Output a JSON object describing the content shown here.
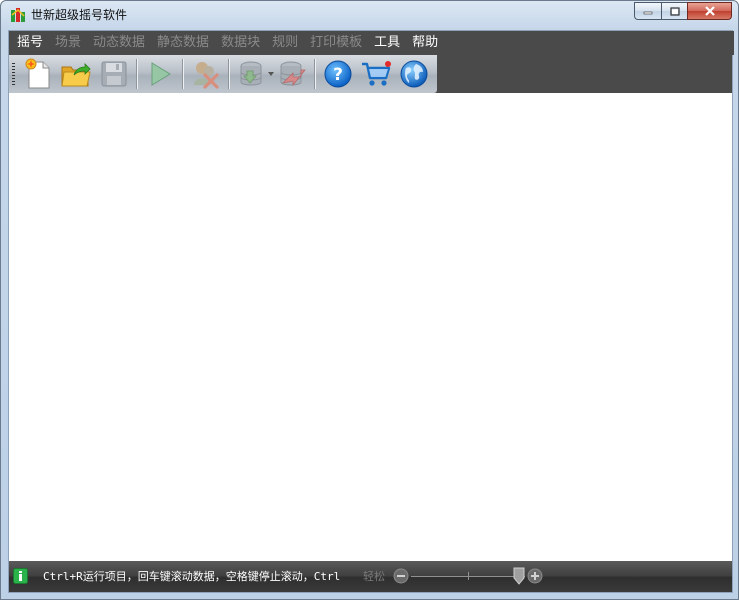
{
  "window": {
    "title": "世新超级摇号软件"
  },
  "menu": {
    "items": [
      {
        "label": "摇号",
        "enabled": true
      },
      {
        "label": "场景",
        "enabled": false
      },
      {
        "label": "动态数据",
        "enabled": false
      },
      {
        "label": "静态数据",
        "enabled": false
      },
      {
        "label": "数据块",
        "enabled": false
      },
      {
        "label": "规则",
        "enabled": false
      },
      {
        "label": "打印模板",
        "enabled": false
      },
      {
        "label": "工具",
        "enabled": true
      },
      {
        "label": "帮助",
        "enabled": true
      }
    ]
  },
  "toolbar": {
    "icons": [
      "new-file-icon",
      "open-folder-icon",
      "save-icon",
      "play-icon",
      "delete-data-icon",
      "import-data-icon",
      "export-data-icon",
      "help-icon",
      "cart-icon",
      "globe-icon"
    ]
  },
  "status": {
    "text": "Ctrl+R运行项目，回车键滚动数据，空格键停止滚动，Ctrl",
    "faded_text": "轻松"
  },
  "colors": {
    "menubar": "#4a4a4a",
    "menu_enabled": "#ffffff",
    "menu_disabled": "#8a8a8a",
    "status_bg": "#3a3a3a"
  }
}
